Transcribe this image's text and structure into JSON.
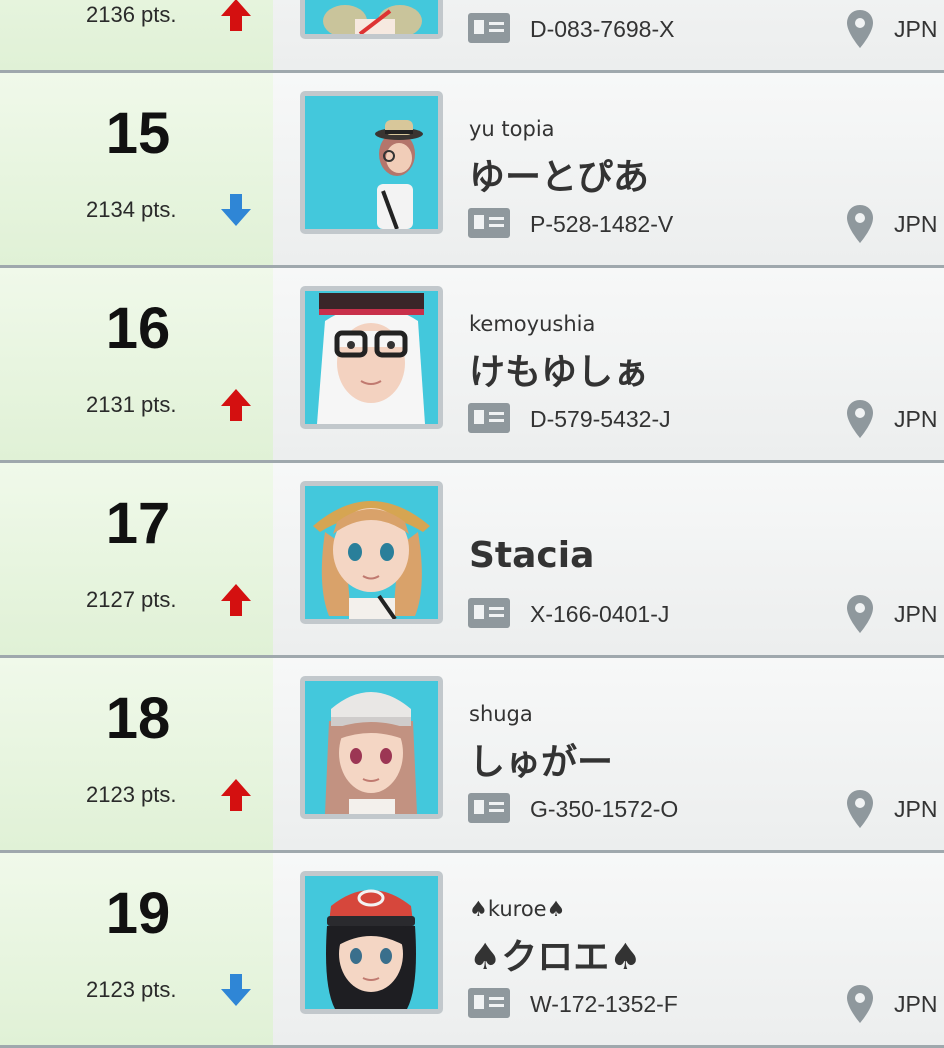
{
  "rows": [
    {
      "rank": "",
      "points": "2136 pts.",
      "trend": "up",
      "english_name": "",
      "japanese_name": "",
      "trainer_id": "D-083-7698-X",
      "country": "JPN"
    },
    {
      "rank": "15",
      "points": "2134 pts.",
      "trend": "down",
      "english_name": "yu topia",
      "japanese_name": "ゆーとぴあ",
      "trainer_id": "P-528-1482-V",
      "country": "JPN"
    },
    {
      "rank": "16",
      "points": "2131 pts.",
      "trend": "up",
      "english_name": "kemoyushia",
      "japanese_name": "けもゆしぁ",
      "trainer_id": "D-579-5432-J",
      "country": "JPN"
    },
    {
      "rank": "17",
      "points": "2127 pts.",
      "trend": "up",
      "english_name": "",
      "display_name": "Stacia",
      "trainer_id": "X-166-0401-J",
      "country": "JPN"
    },
    {
      "rank": "18",
      "points": "2123 pts.",
      "trend": "up",
      "english_name": "shuga",
      "japanese_name": "しゅがー",
      "trainer_id": "G-350-1572-O",
      "country": "JPN"
    },
    {
      "rank": "19",
      "points": "2123 pts.",
      "trend": "down",
      "english_name": "♠kuroe♠",
      "japanese_name": "♠クロエ♠",
      "trainer_id": "W-172-1352-F",
      "country": "JPN"
    }
  ],
  "icons": {
    "trend_up": "red-up-arrow-icon",
    "trend_down": "blue-down-arrow-icon",
    "id": "trainer-card-icon",
    "location": "location-pin-icon"
  },
  "colors": {
    "trend_up": "#d41010",
    "trend_down": "#2f86d6",
    "avatar_bg": "#43c8dc",
    "rank_cell": "#e4f3db",
    "divider": "#9fa8ad"
  }
}
